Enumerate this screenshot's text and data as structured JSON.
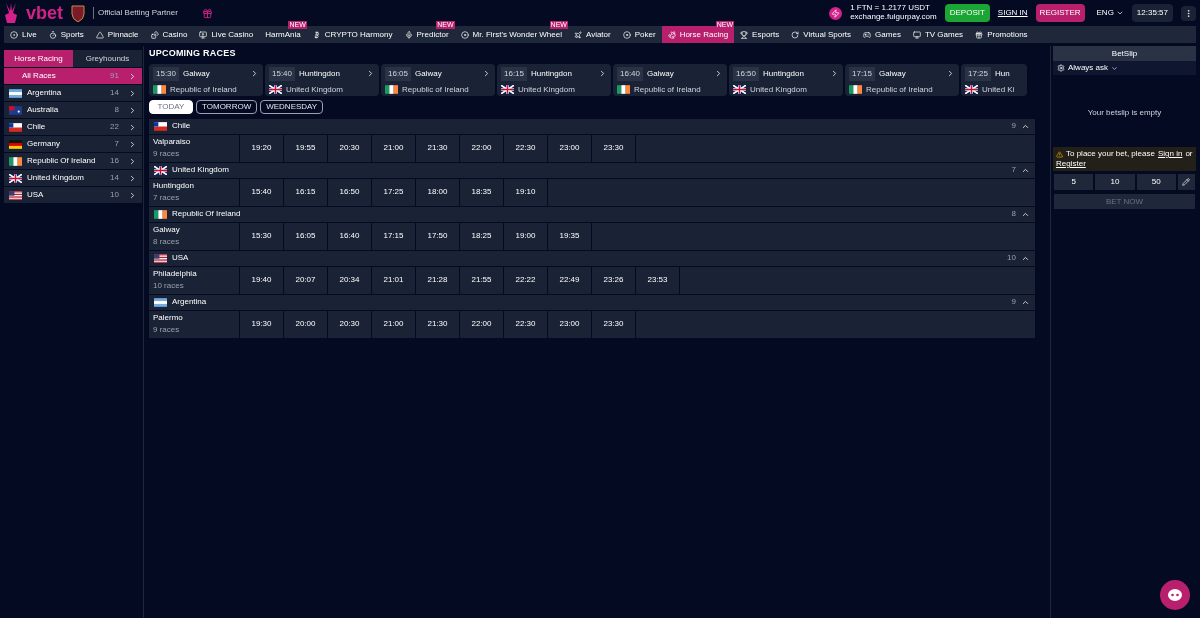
{
  "header": {
    "logo": "vbet",
    "partner": "Official Betting Partner",
    "exchange_rate": "1 FTN = 1.2177 USDT",
    "exchange_site": "exchange.fulgurpay.com",
    "deposit": "DEPOSIT",
    "sign_in": "SIGN IN",
    "register": "REGISTER",
    "language": "ENG",
    "clock": "12:35:57"
  },
  "nav": [
    {
      "label": "Live",
      "selected": false
    },
    {
      "label": "Sports",
      "selected": false
    },
    {
      "label": "Pinnacle",
      "selected": false
    },
    {
      "label": "Casino",
      "selected": false
    },
    {
      "label": "Live Casino",
      "selected": false
    },
    {
      "label": "HarmAnia",
      "badge": "NEW",
      "selected": false
    },
    {
      "label": "CRYPTO Harmony",
      "selected": false
    },
    {
      "label": "Predictor",
      "badge": "NEW",
      "selected": false
    },
    {
      "label": "Mr. First's Wonder Wheel",
      "badge": "NEW",
      "selected": false
    },
    {
      "label": "Aviator",
      "selected": false
    },
    {
      "label": "Poker",
      "selected": false
    },
    {
      "label": "Horse Racing",
      "badge": "NEW",
      "selected": true
    },
    {
      "label": "Esports",
      "selected": false
    },
    {
      "label": "Virtual Sports",
      "selected": false
    },
    {
      "label": "Games",
      "selected": false
    },
    {
      "label": "TV Games",
      "selected": false
    },
    {
      "label": "Promotions",
      "selected": false
    }
  ],
  "sidebar": {
    "tabs": [
      {
        "label": "Horse Racing",
        "selected": true
      },
      {
        "label": "Greyhounds",
        "selected": false
      }
    ],
    "items": [
      {
        "label": "All Races",
        "count": "91",
        "kind": "all",
        "selected": true
      },
      {
        "label": "Argentina",
        "count": "14",
        "kind": "argentina",
        "selected": false
      },
      {
        "label": "Australia",
        "count": "8",
        "kind": "australia",
        "selected": false
      },
      {
        "label": "Chile",
        "count": "22",
        "kind": "chile",
        "selected": false
      },
      {
        "label": "Germany",
        "count": "7",
        "kind": "germany",
        "selected": false
      },
      {
        "label": "Republic Of Ireland",
        "count": "16",
        "kind": "ireland",
        "selected": false
      },
      {
        "label": "United Kingdom",
        "count": "14",
        "kind": "uk",
        "selected": false
      },
      {
        "label": "USA",
        "count": "10",
        "kind": "usa",
        "selected": false
      }
    ]
  },
  "upcoming": {
    "title": "UPCOMING RACES",
    "races": [
      {
        "time": "15:30",
        "track": "Galway",
        "country": "Republic of Ireland",
        "kind": "ireland"
      },
      {
        "time": "15:40",
        "track": "Huntingdon",
        "country": "United Kingdom",
        "kind": "uk"
      },
      {
        "time": "16:05",
        "track": "Galway",
        "country": "Republic of Ireland",
        "kind": "ireland"
      },
      {
        "time": "16:15",
        "track": "Huntingdon",
        "country": "United Kingdom",
        "kind": "uk"
      },
      {
        "time": "16:40",
        "track": "Galway",
        "country": "Republic of Ireland",
        "kind": "ireland"
      },
      {
        "time": "16:50",
        "track": "Huntingdon",
        "country": "United Kingdom",
        "kind": "uk"
      },
      {
        "time": "17:15",
        "track": "Galway",
        "country": "Republic of Ireland",
        "kind": "ireland"
      },
      {
        "time": "17:25",
        "track": "Hun",
        "country": "United Ki",
        "kind": "uk"
      }
    ]
  },
  "day_tabs": [
    {
      "label": "TODAY",
      "selected": true
    },
    {
      "label": "TOMORROW",
      "selected": false
    },
    {
      "label": "WEDNESDAY",
      "selected": false
    }
  ],
  "groups": [
    {
      "country": "Chile",
      "kind": "chile",
      "count": "9",
      "expanded": true,
      "track": "Valparaiso",
      "races": "9 races",
      "times": [
        "19:20",
        "19:55",
        "20:30",
        "21:00",
        "21:30",
        "22:00",
        "22:30",
        "23:00",
        "23:30"
      ]
    },
    {
      "country": "United Kingdom",
      "kind": "uk",
      "count": "7",
      "expanded": true,
      "track": "Huntingdon",
      "races": "7 races",
      "times": [
        "15:40",
        "16:15",
        "16:50",
        "17:25",
        "18:00",
        "18:35",
        "19:10"
      ]
    },
    {
      "country": "Republic Of Ireland",
      "kind": "ireland",
      "count": "8",
      "expanded": true,
      "track": "Galway",
      "races": "8 races",
      "times": [
        "15:30",
        "16:05",
        "16:40",
        "17:15",
        "17:50",
        "18:25",
        "19:00",
        "19:35"
      ]
    },
    {
      "country": "USA",
      "kind": "usa",
      "count": "10",
      "expanded": true,
      "track": "Philadelphia",
      "races": "10 races",
      "times": [
        "19:40",
        "20:07",
        "20:34",
        "21:01",
        "21:28",
        "21:55",
        "22:22",
        "22:49",
        "23:26",
        "23:53"
      ]
    },
    {
      "country": "Argentina",
      "kind": "argentina",
      "count": "9",
      "expanded": true,
      "track": "Palermo",
      "races": "9 races",
      "times": [
        "19:30",
        "20:00",
        "20:30",
        "21:00",
        "21:30",
        "22:00",
        "22:30",
        "23:00",
        "23:30"
      ]
    }
  ],
  "betslip": {
    "title": "BetSlip",
    "mode": "Always ask",
    "empty": "Your betslip is empty",
    "notice": "To place your bet, please",
    "sign_in": "Sign in",
    "or": "or",
    "register": "Register",
    "stakes": [
      "5",
      "10",
      "50"
    ],
    "bet_now": "BET NOW",
    "bet_disabled": true
  }
}
